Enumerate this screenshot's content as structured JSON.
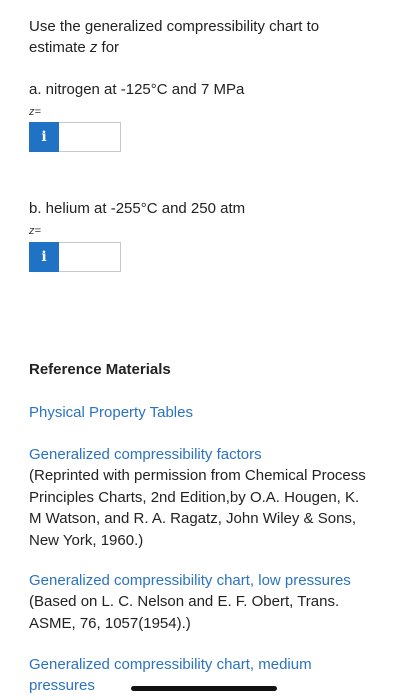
{
  "question": {
    "prefix": "Use the generalized compressibility chart to",
    "line2_prefix": "estimate ",
    "var": "z",
    "line2_suffix": " for"
  },
  "parts": [
    {
      "label": "a. nitrogen at -125°C and 7 MPa",
      "z_label": "z=",
      "info_glyph": "i",
      "value": ""
    },
    {
      "label": "b. helium at -255°C and 250 atm",
      "z_label": "z=",
      "info_glyph": "i",
      "value": ""
    }
  ],
  "reference": {
    "heading": "Reference Materials",
    "links": [
      {
        "label": "Physical Property Tables"
      },
      {
        "label": "Generalized compressibility factors",
        "note": "(Reprinted with permission from Chemical Process Principles Charts, 2nd Edition,by O.A. Hougen, K. M Watson, and R. A. Ragatz, John Wiley & Sons, New York, 1960.)"
      },
      {
        "label": "Generalized compressibility chart, low pressures",
        "note": "(Based on L. C. Nelson and E. F. Obert, Trans. ASME, 76, 1057(1954).)"
      },
      {
        "label": "Generalized compressibility chart, medium pressures"
      }
    ]
  },
  "colors": {
    "link": "#2a73c0",
    "info_button": "#1f72c4"
  },
  "icons": {
    "info": "info-icon"
  }
}
